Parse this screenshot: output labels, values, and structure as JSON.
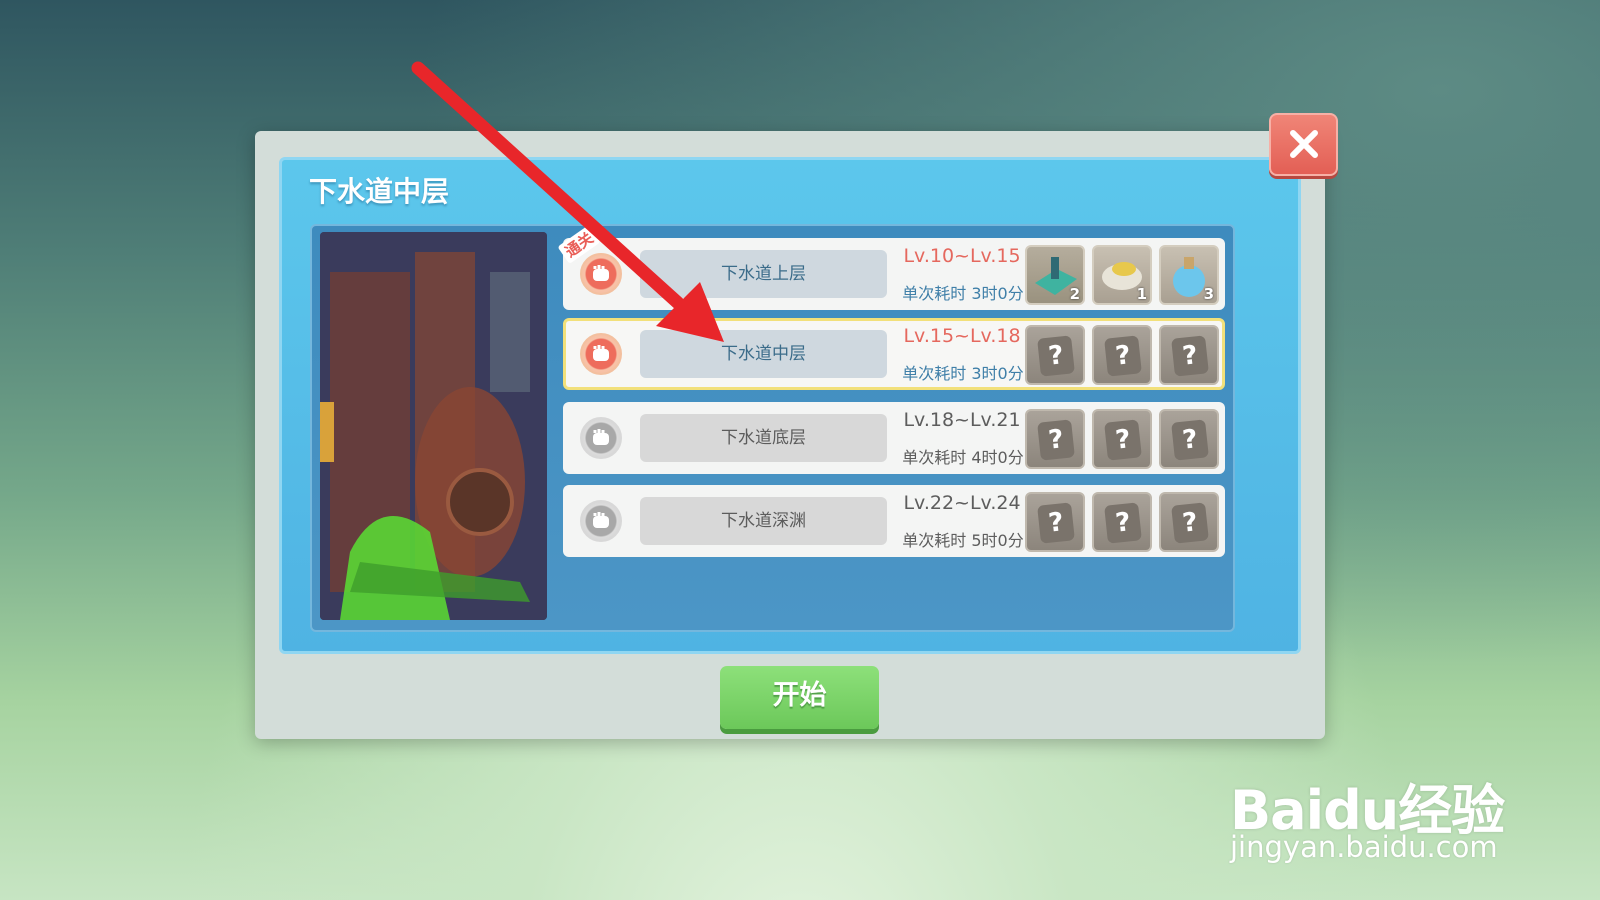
{
  "dialog": {
    "title": "下水道中层",
    "start_label": "开始"
  },
  "dungeons": [
    {
      "name": "下水道上层",
      "level": "Lv.10~Lv.15",
      "time": "单次耗时 3时0分",
      "status": "active",
      "cleared_tag": "通关",
      "rewards": [
        {
          "icon": "green-device-icon",
          "count": "2"
        },
        {
          "icon": "gold-pipe-icon",
          "count": "1"
        },
        {
          "icon": "blue-potion-icon",
          "count": "3"
        }
      ]
    },
    {
      "name": "下水道中层",
      "level": "Lv.15~Lv.18",
      "time": "单次耗时 3时0分",
      "status": "active",
      "rewards": [
        {
          "icon": "unknown-icon",
          "symbol": "?"
        },
        {
          "icon": "unknown-icon",
          "symbol": "?"
        },
        {
          "icon": "unknown-icon",
          "symbol": "?"
        }
      ]
    },
    {
      "name": "下水道底层",
      "level": "Lv.18~Lv.21",
      "time": "单次耗时 4时0分",
      "status": "locked",
      "rewards": [
        {
          "icon": "unknown-icon",
          "symbol": "?"
        },
        {
          "icon": "unknown-icon",
          "symbol": "?"
        },
        {
          "icon": "unknown-icon",
          "symbol": "?"
        }
      ]
    },
    {
      "name": "下水道深渊",
      "level": "Lv.22~Lv.24",
      "time": "单次耗时 5时0分",
      "status": "locked",
      "rewards": [
        {
          "icon": "unknown-icon",
          "symbol": "?"
        },
        {
          "icon": "unknown-icon",
          "symbol": "?"
        },
        {
          "icon": "unknown-icon",
          "symbol": "?"
        }
      ]
    }
  ],
  "watermark": {
    "brand": "Baidu经验",
    "url": "jingyan.baidu.com"
  },
  "colors": {
    "panel_blue": "#55bde8",
    "start_green": "#77d265",
    "close_red": "#e8695e",
    "level_red": "#e5685e",
    "arrow_red": "#e8262a"
  }
}
